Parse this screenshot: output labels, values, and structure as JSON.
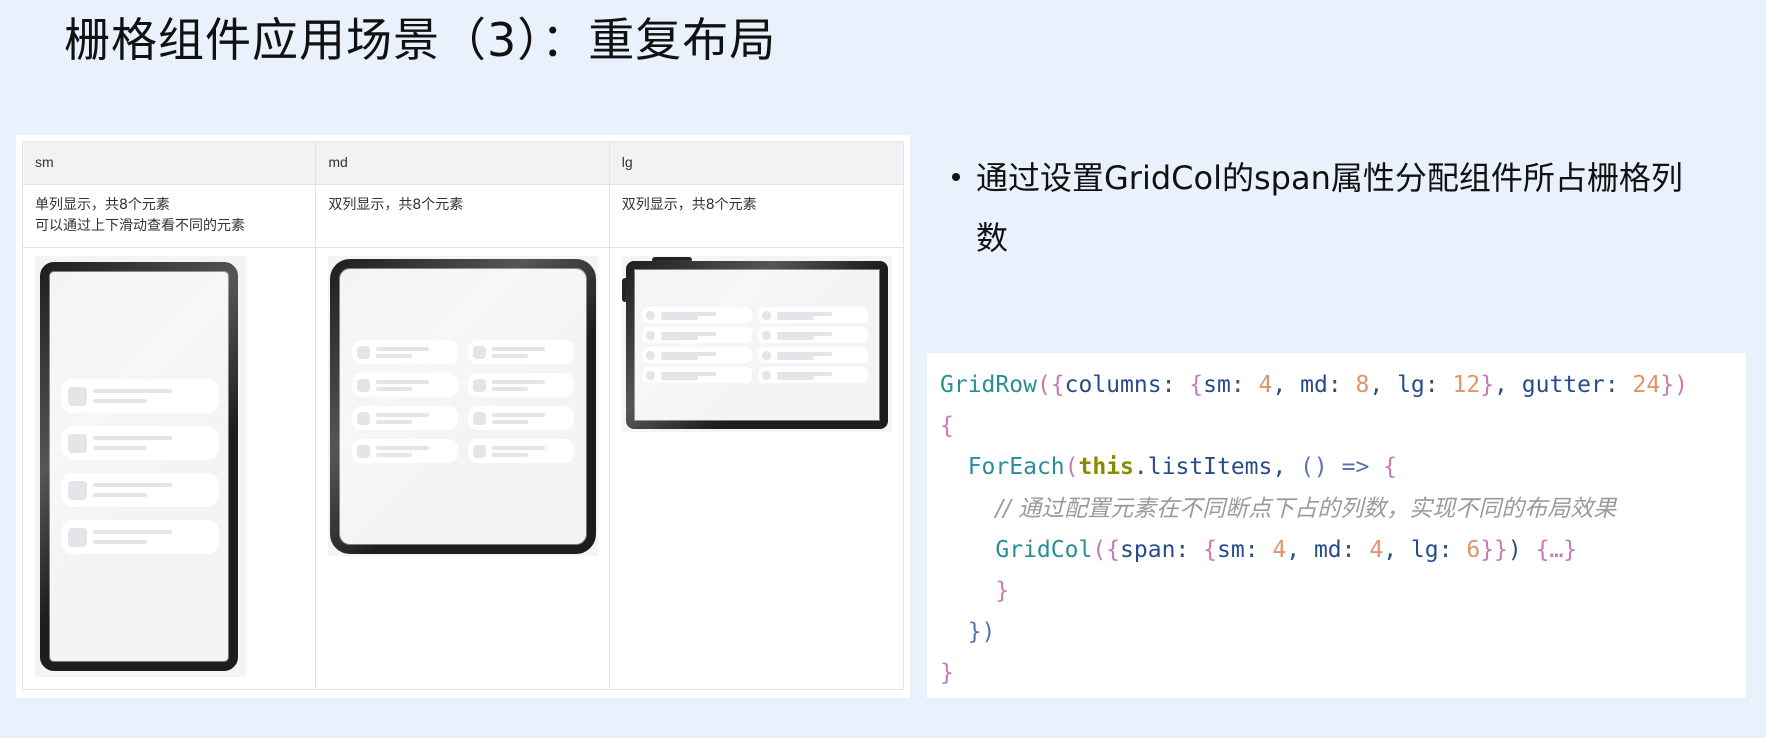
{
  "title": "栅格组件应用场景（3）：重复布局",
  "table": {
    "headers": [
      "sm",
      "md",
      "lg"
    ],
    "descriptions": [
      [
        "单列显示，共8个元素",
        "可以通过上下滑动查看不同的元素"
      ],
      [
        "双列显示，共8个元素"
      ],
      [
        "双列显示，共8个元素"
      ]
    ]
  },
  "devices": [
    {
      "type": "phone",
      "columns": 1,
      "visible_items": 4
    },
    {
      "type": "foldable",
      "columns": 2,
      "visible_items": 8
    },
    {
      "type": "tablet",
      "columns": 2,
      "visible_items": 8
    }
  ],
  "bullet_text": "通过设置GridCol的span属性分配组件所占栅格列数",
  "code": {
    "lines": [
      [
        [
          "fn",
          "GridRow"
        ],
        [
          "br",
          "({"
        ],
        [
          "id",
          "columns"
        ],
        [
          "p",
          ": "
        ],
        [
          "br",
          "{"
        ],
        [
          "id",
          "sm"
        ],
        [
          "p",
          ": "
        ],
        [
          "num",
          "4"
        ],
        [
          "p",
          ", "
        ],
        [
          "id",
          "md"
        ],
        [
          "p",
          ": "
        ],
        [
          "num",
          "8"
        ],
        [
          "p",
          ", "
        ],
        [
          "id",
          "lg"
        ],
        [
          "p",
          ": "
        ],
        [
          "num",
          "12"
        ],
        [
          "br",
          "}"
        ],
        [
          "p",
          ", "
        ],
        [
          "id",
          "gutter"
        ],
        [
          "p",
          ": "
        ],
        [
          "num",
          "24"
        ],
        [
          "br",
          "})"
        ]
      ],
      [
        [
          "br",
          "{"
        ]
      ],
      [
        [
          "pl",
          "  "
        ],
        [
          "fn",
          "ForEach"
        ],
        [
          "br",
          "("
        ],
        [
          "kw",
          "this"
        ],
        [
          "p",
          "."
        ],
        [
          "id",
          "listItems"
        ],
        [
          "p",
          ", "
        ],
        [
          "op",
          "() => "
        ],
        [
          "br",
          "{"
        ]
      ],
      [
        [
          "pl",
          "    "
        ],
        [
          "cm",
          "// 通过配置元素在不同断点下占的列数，实现不同的布局效果"
        ]
      ],
      [
        [
          "pl",
          "    "
        ],
        [
          "fn",
          "GridCol"
        ],
        [
          "br",
          "({"
        ],
        [
          "id",
          "span"
        ],
        [
          "p",
          ": "
        ],
        [
          "br",
          "{"
        ],
        [
          "id",
          "sm"
        ],
        [
          "p",
          ": "
        ],
        [
          "num",
          "4"
        ],
        [
          "p",
          ", "
        ],
        [
          "id",
          "md"
        ],
        [
          "p",
          ": "
        ],
        [
          "num",
          "4"
        ],
        [
          "p",
          ", "
        ],
        [
          "id",
          "lg"
        ],
        [
          "p",
          ": "
        ],
        [
          "num",
          "6"
        ],
        [
          "br",
          "}}"
        ],
        [
          "p",
          ") "
        ],
        [
          "br",
          "{…}"
        ]
      ],
      [
        [
          "pl",
          "    "
        ],
        [
          "br",
          "}"
        ]
      ],
      [
        [
          "pl",
          "  "
        ],
        [
          "op",
          "})"
        ]
      ],
      [
        [
          "br",
          "}"
        ]
      ]
    ]
  }
}
